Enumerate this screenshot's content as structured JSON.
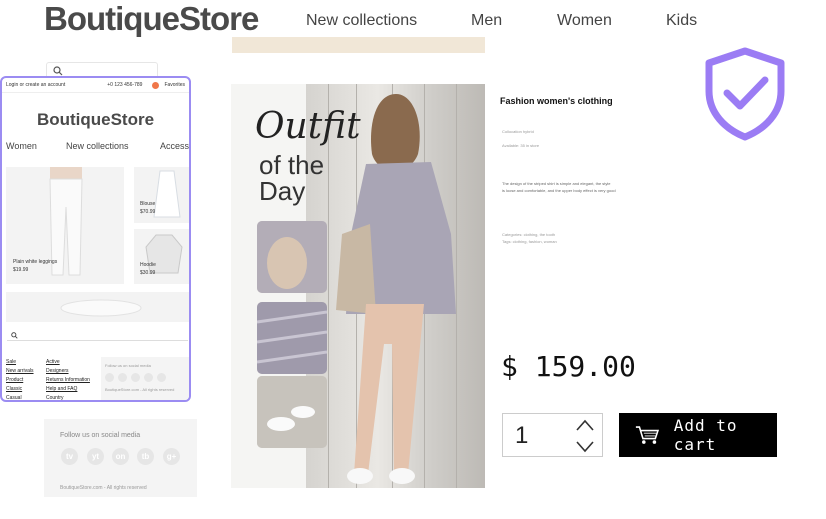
{
  "header": {
    "logo": "BoutiqueStore",
    "nav": [
      "New collections",
      "Men",
      "Women",
      "Kids"
    ]
  },
  "mobile_preview": {
    "top_bar": {
      "login": "Login or create an account",
      "phone": "+0 123 456-789",
      "favorites": "Favorites"
    },
    "logo": "BoutiqueStore",
    "nav": [
      "Women",
      "New collections",
      "Accessories"
    ],
    "products": [
      {
        "name": "Plain white leggings",
        "price": "$19.99"
      },
      {
        "name": "Blouse",
        "price": "$70.99"
      },
      {
        "name": "Hoodie",
        "price": "$30.99"
      }
    ],
    "footer_col1": [
      "Sale",
      "New arrivals",
      "Product",
      "Classic",
      "Casual"
    ],
    "footer_col2": [
      "Active",
      "Designers",
      "Returns Information",
      "Help and FAQ",
      "Country"
    ],
    "social_title": "Follow us on social media",
    "copyright": "BoutiqueStore.com - All rights reserved"
  },
  "social": {
    "title": "Follow us on social media",
    "icons": [
      "tv",
      "yt",
      "on",
      "tb",
      "g+"
    ],
    "copyright": "BoutiqueStore.com - All rights reserved"
  },
  "banner": {
    "line1": "Outfit",
    "line2": "of the",
    "line3": "Day"
  },
  "product": {
    "title": "Fashion women's clothing",
    "meta1": "Collocation hybrid",
    "meta2": "Available: 35 in store",
    "description1": "The design of the striped shirt is simple and elegant, the style",
    "description2": "is loose and comfortable, and the upper body effect is very good",
    "category1": "Categories: clothing, the tooth",
    "category2": "Tags: clothing, fashion, woman",
    "price": "$ 159.00",
    "quantity": "1",
    "add_to_cart": "Add to cart"
  },
  "colors": {
    "accent": "#9b7cf4",
    "button": "#000000",
    "banner_beige": "#f1e7d7"
  },
  "icons": [
    "search-icon",
    "shield-check-icon",
    "cart-icon",
    "chevron-up-icon",
    "chevron-down-icon",
    "heart-icon"
  ]
}
